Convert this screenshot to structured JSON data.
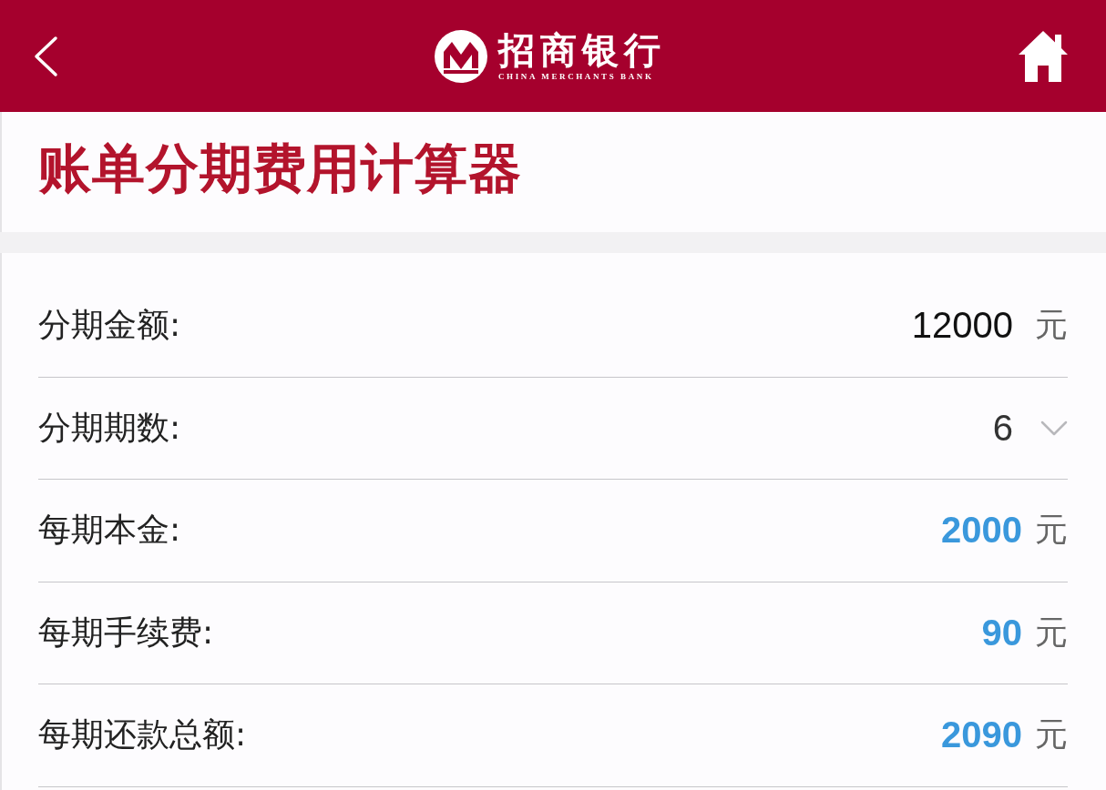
{
  "header": {
    "brand_name": "招商银行",
    "brand_subtitle": "CHINA MERCHANTS BANK"
  },
  "title": "账单分期费用计算器",
  "rows": [
    {
      "kind": "input",
      "label": "分期金额:",
      "value": "12000",
      "unit": "元"
    },
    {
      "kind": "select",
      "label": "分期期数:",
      "value": "6"
    },
    {
      "kind": "result",
      "label": "每期本金:",
      "value": "2000",
      "unit": "元"
    },
    {
      "kind": "result",
      "label": "每期手续费:",
      "value": "90",
      "unit": "元"
    },
    {
      "kind": "result",
      "label": "每期还款总额:",
      "value": "2090",
      "unit": "元"
    }
  ]
}
